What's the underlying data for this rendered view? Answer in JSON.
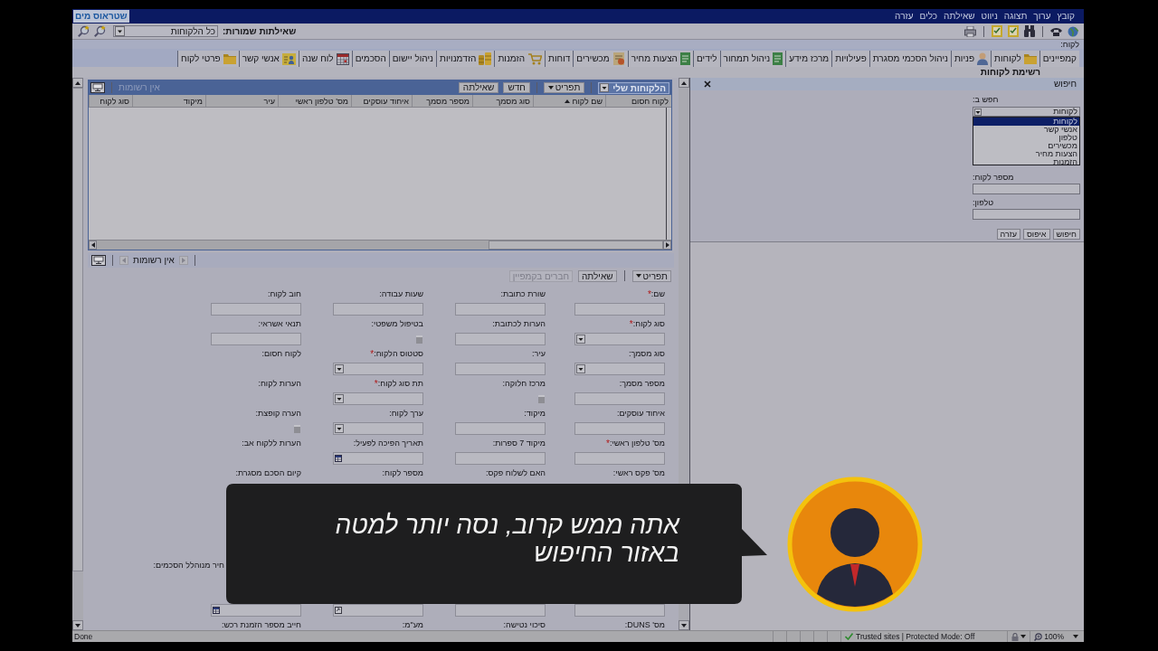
{
  "window": {
    "logo": "שטראוס מים",
    "menu": [
      "קובץ",
      "ערוך",
      "תצוגה",
      "ניווט",
      "שאילתה",
      "כלים",
      "עזרה"
    ]
  },
  "toolbar": {
    "saved_queries_label": "שאילתות שמורות:",
    "saved_query": "כל הלקוחות"
  },
  "record_bar": {
    "label": "לקוח:"
  },
  "tabs": [
    "קמפיינים",
    "לקוחות",
    "פניות",
    "ניהול הסכמי מסגרת",
    "פעילויות",
    "מרכז מידע",
    "ניהול תמחור",
    "לידים",
    "הצעות מחיר",
    "מכשירים",
    "דוחות",
    "הזמנות",
    "הזדמנויות",
    "ניהול יישום",
    "הסכמים",
    "לוח שנה",
    "אנשי קשר",
    "פרטי לקוח"
  ],
  "page_title": "רשימת לקוחות",
  "grid": {
    "view": "הלקוחות שלי",
    "menu_button": "תפריט",
    "buttons": [
      "חדש",
      "שאילתה"
    ],
    "record_count": "אין רשומות",
    "columns": [
      {
        "label": "לקוח חסום",
        "sorted": false
      },
      {
        "label": "שם לקוח",
        "sorted": true
      },
      {
        "label": "סוג מסמך",
        "sorted": false
      },
      {
        "label": "מספר מסמך",
        "sorted": false
      },
      {
        "label": "איחוד עוסקים",
        "sorted": false
      },
      {
        "label": "מס' טלפון ראשי",
        "sorted": false
      },
      {
        "label": "עיר",
        "sorted": false
      },
      {
        "label": "מיקוד",
        "sorted": false
      },
      {
        "label": "סוג לקוח",
        "sorted": false
      }
    ]
  },
  "pager": {
    "record_count": "אין רשומות"
  },
  "form": {
    "toolbar": {
      "menu_button": "תפריט",
      "buttons": [
        {
          "label": "שאילתה",
          "disabled": false
        },
        {
          "label": "חברים בקמפיין",
          "disabled": true
        }
      ]
    },
    "rows": [
      {
        "fields": [
          {
            "label": "שם:",
            "required_mark": "*",
            "kind": "text"
          },
          {
            "label": "שורת כתובת:",
            "kind": "text"
          },
          {
            "label": "שעות עבודה:",
            "kind": "text"
          },
          {
            "label": "חוב לקוח:",
            "kind": "text"
          }
        ]
      },
      {
        "fields": [
          {
            "label": "סוג לקוח:",
            "required_mark": "*",
            "kind": "select"
          },
          {
            "label": "הערות לכתובת:",
            "kind": "text"
          },
          {
            "label": "בטיפול משפטי:",
            "kind": "checkbox",
            "checked": false
          },
          {
            "label": "תנאי אשראי:",
            "kind": "text"
          }
        ]
      },
      {
        "fields": [
          {
            "label": "סוג מסמך:",
            "kind": "select"
          },
          {
            "label": "עיר:",
            "kind": "text"
          },
          {
            "label": "סטטוס הלקוח:",
            "required_mark": "*",
            "kind": "select"
          },
          {
            "label": "לקוח חסום:"
          }
        ]
      },
      {
        "fields": [
          {
            "label": "מספר מסמך:",
            "kind": "text"
          },
          {
            "label": "מרכז חלוקה:",
            "kind": "checkbox",
            "checked": false
          },
          {
            "label": "תת סוג לקוח:",
            "required_mark": "*",
            "kind": "select"
          },
          {
            "label": "הערות לקוח:"
          }
        ]
      },
      {
        "fields": [
          {
            "label": "איחוד עוסקים:",
            "kind": "text"
          },
          {
            "label": "מיקוד:",
            "kind": "text"
          },
          {
            "label": "ערך לקוח:",
            "kind": "select"
          },
          {
            "label": "הערה קופצת:",
            "kind": "checkbox",
            "checked": false
          }
        ]
      },
      {
        "fields": [
          {
            "label": "מס' טלפון ראשי:",
            "required_mark": "*",
            "kind": "text"
          },
          {
            "label": "מיקוד 7 ספרות:",
            "kind": "text"
          },
          {
            "label": "תאריך הפיכה לפעיל:",
            "kind": "date"
          },
          {
            "label": "הערות ללקוח אב:"
          }
        ]
      },
      {
        "fields": [
          {
            "label": "מס' פקס ראשי:"
          },
          {
            "label": "האם לשלוח פקס:"
          },
          {
            "label": "מספר לקוח:"
          },
          {
            "label": "קיום הסכם מסגרת:"
          }
        ]
      }
    ],
    "rows_below": [
      {
        "kind": "cut",
        "fields": [
          {
            "label": "חיר מנוהלל הסכמים:"
          }
        ]
      },
      {
        "fields": [
          {
            "kind": "text"
          },
          {
            "kind": "text"
          },
          {
            "kind": "lookup"
          },
          {
            "kind": "date"
          }
        ]
      },
      {
        "fields": [
          {
            "label": "מס' DUNS:"
          },
          {
            "label": "סיכוי נטישה:"
          },
          {
            "label": "מע\"מ:"
          },
          {
            "label": "חייב מספר הזמנת רכש:"
          }
        ]
      }
    ]
  },
  "search_panel": {
    "title": "חיפוש",
    "search_in_label": "חפש ב:",
    "search_in_value": "לקוחות",
    "options": [
      {
        "label": "לקוחות",
        "selected": true
      },
      {
        "label": "אנשי קשר",
        "selected": false
      },
      {
        "label": "טלפון",
        "selected": false
      },
      {
        "label": "מכשירים",
        "selected": false
      },
      {
        "label": "הצעות מחיר",
        "selected": false
      },
      {
        "label": "הזמנות",
        "selected": false
      }
    ],
    "fields": [
      {
        "label": "מספר לקוח:"
      },
      {
        "label": "טלפון:"
      }
    ],
    "buttons": [
      "חיפוש",
      "איפוס",
      "עזרה"
    ]
  },
  "tutorial": {
    "message_lines": [
      "אתה ממש קרוב, נסה יותר למטה",
      "באזור החיפוש"
    ]
  },
  "status_bar": {
    "status": "Done",
    "zone": "Trusted sites | Protected Mode: Off",
    "zoom": "100%"
  }
}
